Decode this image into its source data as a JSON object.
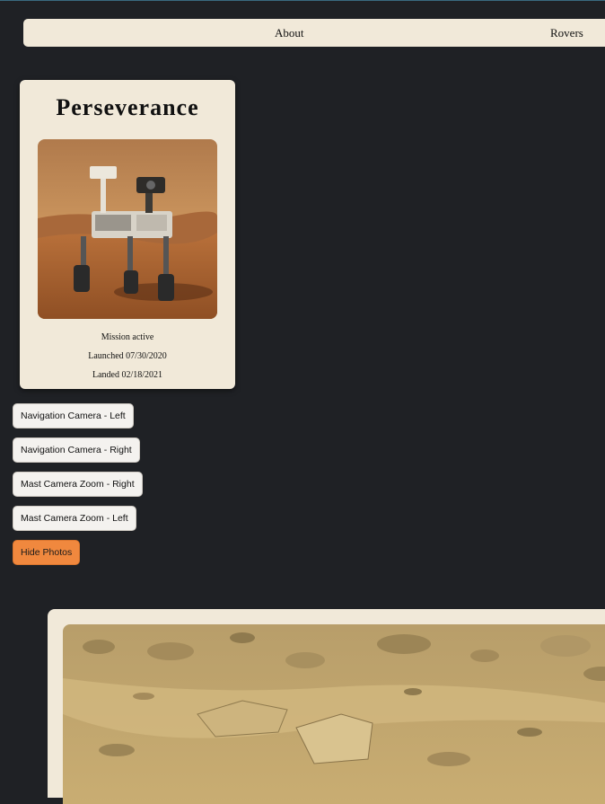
{
  "nav": {
    "about_label": "About",
    "rovers_label": "Rovers"
  },
  "rover": {
    "name": "Perseverance",
    "photo_icon": "rover-photo",
    "status": "Mission active",
    "launched": "Launched 07/30/2020",
    "landed": "Landed 02/18/2021"
  },
  "cameras": {
    "buttons": [
      "Navigation Camera - Left",
      "Navigation Camera - Right",
      "Mast Camera Zoom - Right",
      "Mast Camera Zoom - Left"
    ],
    "hide_label": "Hide Photos"
  },
  "colors": {
    "background": "#1f2125",
    "card": "#f1e9d9",
    "accent": "#f0883e"
  }
}
